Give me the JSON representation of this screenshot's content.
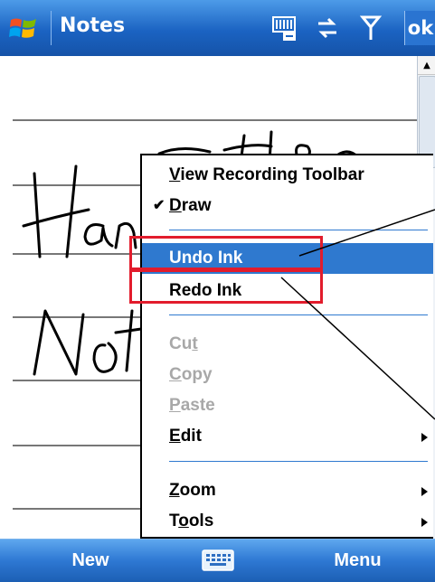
{
  "title_bar": {
    "app_title": "Notes",
    "ok_label": "ok",
    "status_icons": [
      "sip-keyboard-icon",
      "connectivity-icon",
      "signal-icon",
      "volume-icon"
    ]
  },
  "canvas": {
    "handwriting": "Handwritten Notes"
  },
  "context_menu": {
    "items": [
      {
        "label": "View Recording Toolbar",
        "mnemonic": "V",
        "state": "enabled"
      },
      {
        "label": "Draw",
        "mnemonic": "D",
        "state": "checked"
      },
      {
        "label": "Undo Ink",
        "state": "selected"
      },
      {
        "label": "Redo Ink",
        "state": "enabled"
      },
      {
        "label": "Cut",
        "mnemonic": "t",
        "state": "disabled"
      },
      {
        "label": "Copy",
        "mnemonic": "C",
        "state": "disabled"
      },
      {
        "label": "Paste",
        "mnemonic": "P",
        "state": "disabled"
      },
      {
        "label": "Edit",
        "mnemonic": "E",
        "state": "submenu"
      },
      {
        "label": "Zoom",
        "mnemonic": "Z",
        "state": "submenu"
      },
      {
        "label": "Tools",
        "mnemonic": "o",
        "state": "submenu"
      }
    ]
  },
  "bottom_bar": {
    "left_softkey": "New",
    "right_softkey": "Menu"
  },
  "colors": {
    "title_bar_blue": "#1b63c2",
    "menu_highlight": "#2f79cf",
    "callout_red": "#e21c2c",
    "disabled_text": "#a8a8a8"
  }
}
